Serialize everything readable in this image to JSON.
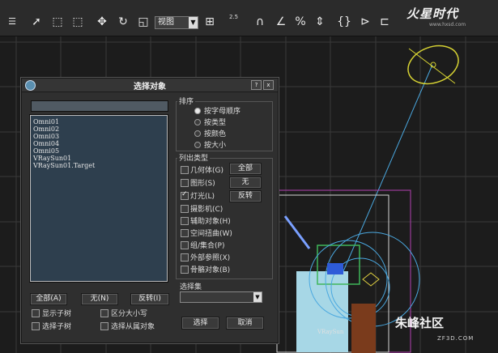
{
  "toolbar": {
    "view_dropdown": "视图",
    "snap_value": "2.5"
  },
  "logo": {
    "text": "火星时代",
    "sub": "www.hxsd.com"
  },
  "viewport": {
    "object_label": "VRaySun"
  },
  "dialog": {
    "title": "选择对象",
    "help_btn": "?",
    "close_btn": "x",
    "search_value": "",
    "objects": [
      "Omni01",
      "Omni02",
      "Omni03",
      "Omni04",
      "Omni05",
      "VRaySun01",
      "VRaySun01.Target"
    ],
    "bottom_buttons": {
      "all": "全部(A)",
      "none": "无(N)",
      "invert": "反转(I)"
    },
    "bottom_checks": {
      "show_children": "显示子树",
      "case_sensitive": "区分大小写",
      "select_children": "选择子树",
      "select_dependents": "选择从属对象"
    },
    "sort": {
      "label": "排序",
      "options": [
        "按字母顺序",
        "按类型",
        "按颜色",
        "按大小"
      ],
      "selected": "按字母顺序"
    },
    "list_types": {
      "label": "列出类型",
      "types": [
        {
          "label": "几何体(G)",
          "checked": false
        },
        {
          "label": "图形(S)",
          "checked": false
        },
        {
          "label": "灯光(L)",
          "checked": true
        },
        {
          "label": "摄影机(C)",
          "checked": false
        },
        {
          "label": "辅助对象(H)",
          "checked": false
        },
        {
          "label": "空间扭曲(W)",
          "checked": false
        },
        {
          "label": "组/集合(P)",
          "checked": false
        },
        {
          "label": "外部参照(X)",
          "checked": false
        },
        {
          "label": "骨骼对象(B)",
          "checked": false
        }
      ],
      "btn_all": "全部",
      "btn_none": "无",
      "btn_invert": "反转"
    },
    "selection_set": {
      "label": "选择集",
      "value": ""
    },
    "select_btn": "选择",
    "cancel_btn": "取消"
  },
  "watermark": {
    "text": "朱峰社区",
    "sub": "ZF3D.COM"
  },
  "colors": {
    "light_gizmo": "#d6d233",
    "sun_line": "#4aa8e0",
    "ground_plane": "#a7d7e6",
    "selection_box": "#b23fb0"
  }
}
